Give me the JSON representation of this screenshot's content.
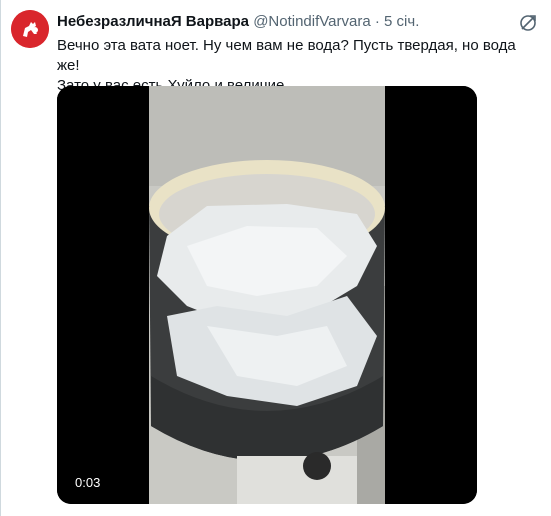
{
  "tweet": {
    "display_name": "НебезразличнаЯ Варвара",
    "handle": "@NotindifVarvara",
    "separator": "·",
    "time": "5 січ.",
    "text_line1": "Вечно эта вата ноет. Ну чем вам не вода? Пусть твердая, но вода же!",
    "text_line2": "Зато у вас есть Хуйло и величие."
  },
  "media": {
    "duration": "0:03"
  },
  "icons": {
    "share": "share-link-icon",
    "avatar": "pahonia-emblem-icon"
  },
  "colors": {
    "avatar_bg": "#d9262c",
    "handle": "#536471",
    "text": "#0f1419"
  }
}
